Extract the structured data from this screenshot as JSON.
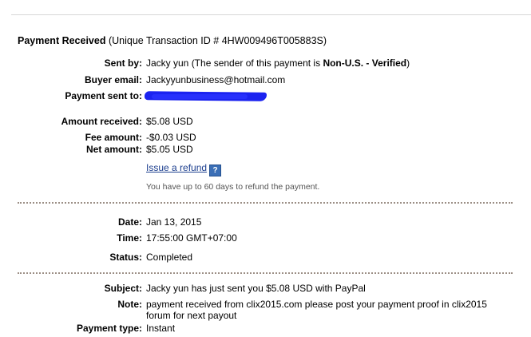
{
  "header": {
    "title": "Payment Received",
    "transaction": "(Unique Transaction ID # 4HW009496T005883S)"
  },
  "sender": {
    "sent_by_label": "Sent by:",
    "sent_by_name": "Jacky yun (The sender of this payment is ",
    "sent_by_status": "Non-U.S. - Verified",
    "sent_by_close": ")",
    "buyer_email_label": "Buyer email:",
    "buyer_email": "Jackyyunbusiness@hotmail.com",
    "sent_to_label": "Payment sent to:"
  },
  "amounts": {
    "received_label": "Amount received:",
    "received": "$5.08 USD",
    "fee_label": "Fee amount:",
    "fee": "-$0.03 USD",
    "net_label": "Net amount:",
    "net": "$5.05 USD",
    "refund_link": "Issue a refund",
    "help_icon_text": "?",
    "refund_note": "You have up to 60 days to refund the payment."
  },
  "details": {
    "date_label": "Date:",
    "date": "Jan 13, 2015",
    "time_label": "Time:",
    "time": "17:55:00 GMT+07:00",
    "status_label": "Status:",
    "status": "Completed"
  },
  "message": {
    "subject_label": "Subject:",
    "subject": "Jacky yun has just sent you $5.08 USD with PayPal",
    "note_label": "Note:",
    "note": "payment received from clix2015.com please post your payment proof in clix2015 forum for next payout",
    "payment_type_label": "Payment type:",
    "payment_type": "Instant"
  },
  "colors": {
    "link": "#1d3f8f",
    "redaction": "#1b23f0",
    "divider": "#9c8f86"
  }
}
